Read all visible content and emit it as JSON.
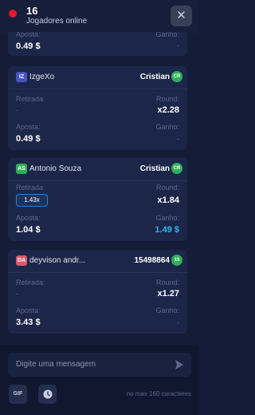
{
  "header": {
    "online_count": "16",
    "online_label": "Jogadores online",
    "close_label": "✕"
  },
  "labels": {
    "retirada": "Retirada:",
    "round": "Round:",
    "aposta": "Aposta:",
    "ganho": "Ganho:",
    "dash": "-"
  },
  "bets": [
    {
      "aposta": "0.49 $"
    },
    {
      "avatar": "IZ",
      "avatar_color": "#4752c4",
      "username": "IzgeXo",
      "opponent": "Cristian",
      "opponent_badge": "CR",
      "round": "x2.28",
      "aposta": "0.49 $"
    },
    {
      "avatar": "AS",
      "avatar_color": "#2eae5a",
      "username": "Antonio Souza",
      "opponent": "Cristian",
      "opponent_badge": "CR",
      "retirada": "1.43x",
      "round": "x1.84",
      "aposta": "1.04 $",
      "ganho": "1.49 $",
      "ganho_color": "#2bb6f0"
    },
    {
      "avatar": "DA",
      "avatar_color": "#e0566b",
      "username": "deyvison andr...",
      "opponent": "15498864",
      "opponent_badge": "15",
      "round": "x1.27",
      "aposta": "3.43 $"
    }
  ],
  "composer": {
    "placeholder": "Digite uma mensagem",
    "gif_label": "GIF",
    "char_limit": "no max 160 caracteres"
  },
  "icons": {
    "send": "send-icon",
    "clock": "clock-icon",
    "close": "close-icon"
  }
}
